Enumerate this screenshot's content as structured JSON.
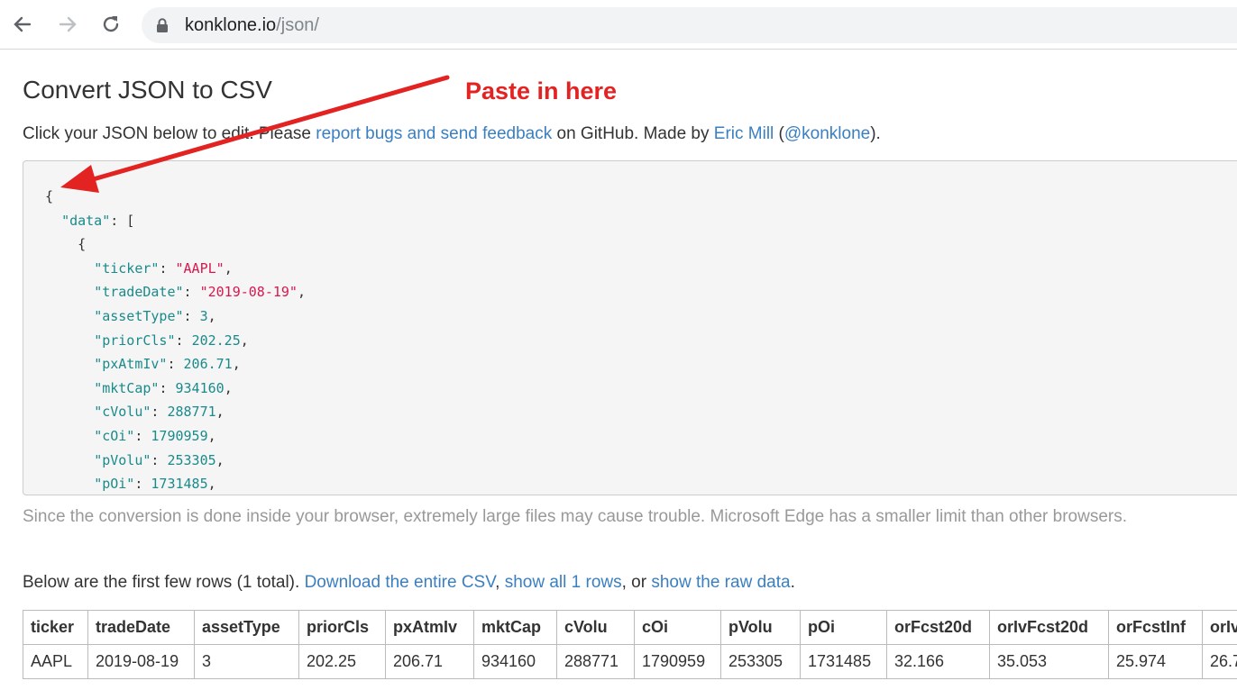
{
  "browser": {
    "url_host": "konklone.io",
    "url_path": "/json/"
  },
  "page": {
    "title": "Convert JSON to CSV",
    "annotation": "Paste in here",
    "intro": {
      "before": "Click your JSON below to edit. Please ",
      "link_feedback": "report bugs and send feedback",
      "mid": " on GitHub. Made by ",
      "link_author": "Eric Mill",
      "paren_open": " (",
      "link_handle": "@konklone",
      "end": ")."
    },
    "note": "Since the conversion is done inside your browser, extremely large files may cause trouble. Microsoft Edge has a smaller limit than other browsers.",
    "below": {
      "before": "Below are the first few rows (1 total). ",
      "link_download": "Download the entire CSV",
      "comma": ", ",
      "link_show_all": "show all 1 rows",
      "or": ", or ",
      "link_raw": "show the raw data",
      "end": "."
    }
  },
  "editor": {
    "lines": [
      {
        "indent": "",
        "text": "{"
      },
      {
        "indent": "  ",
        "key": "\"data\"",
        "text": ": ["
      },
      {
        "indent": "    ",
        "text": "{"
      },
      {
        "indent": "      ",
        "key": "\"ticker\"",
        "str": "\"AAPL\""
      },
      {
        "indent": "      ",
        "key": "\"tradeDate\"",
        "str": "\"2019-08-19\""
      },
      {
        "indent": "      ",
        "key": "\"assetType\"",
        "num": "3"
      },
      {
        "indent": "      ",
        "key": "\"priorCls\"",
        "num": "202.25"
      },
      {
        "indent": "      ",
        "key": "\"pxAtmIv\"",
        "num": "206.71"
      },
      {
        "indent": "      ",
        "key": "\"mktCap\"",
        "num": "934160"
      },
      {
        "indent": "      ",
        "key": "\"cVolu\"",
        "num": "288771"
      },
      {
        "indent": "      ",
        "key": "\"cOi\"",
        "num": "1790959"
      },
      {
        "indent": "      ",
        "key": "\"pVolu\"",
        "num": "253305"
      },
      {
        "indent": "      ",
        "key": "\"pOi\"",
        "num": "1731485"
      }
    ]
  },
  "table": {
    "headers": [
      "ticker",
      "tradeDate",
      "assetType",
      "priorCls",
      "pxAtmIv",
      "mktCap",
      "cVolu",
      "cOi",
      "pVolu",
      "pOi",
      "orFcst20d",
      "orIvFcst20d",
      "orFcstInf",
      "orIv"
    ],
    "rows": [
      [
        "AAPL",
        "2019-08-19",
        "3",
        "202.25",
        "206.71",
        "934160",
        "288771",
        "1790959",
        "253305",
        "1731485",
        "32.166",
        "35.053",
        "25.974",
        "26.7"
      ]
    ],
    "widths": [
      72,
      118,
      116,
      96,
      98,
      92,
      86,
      96,
      88,
      96,
      114,
      132,
      104,
      60
    ]
  }
}
